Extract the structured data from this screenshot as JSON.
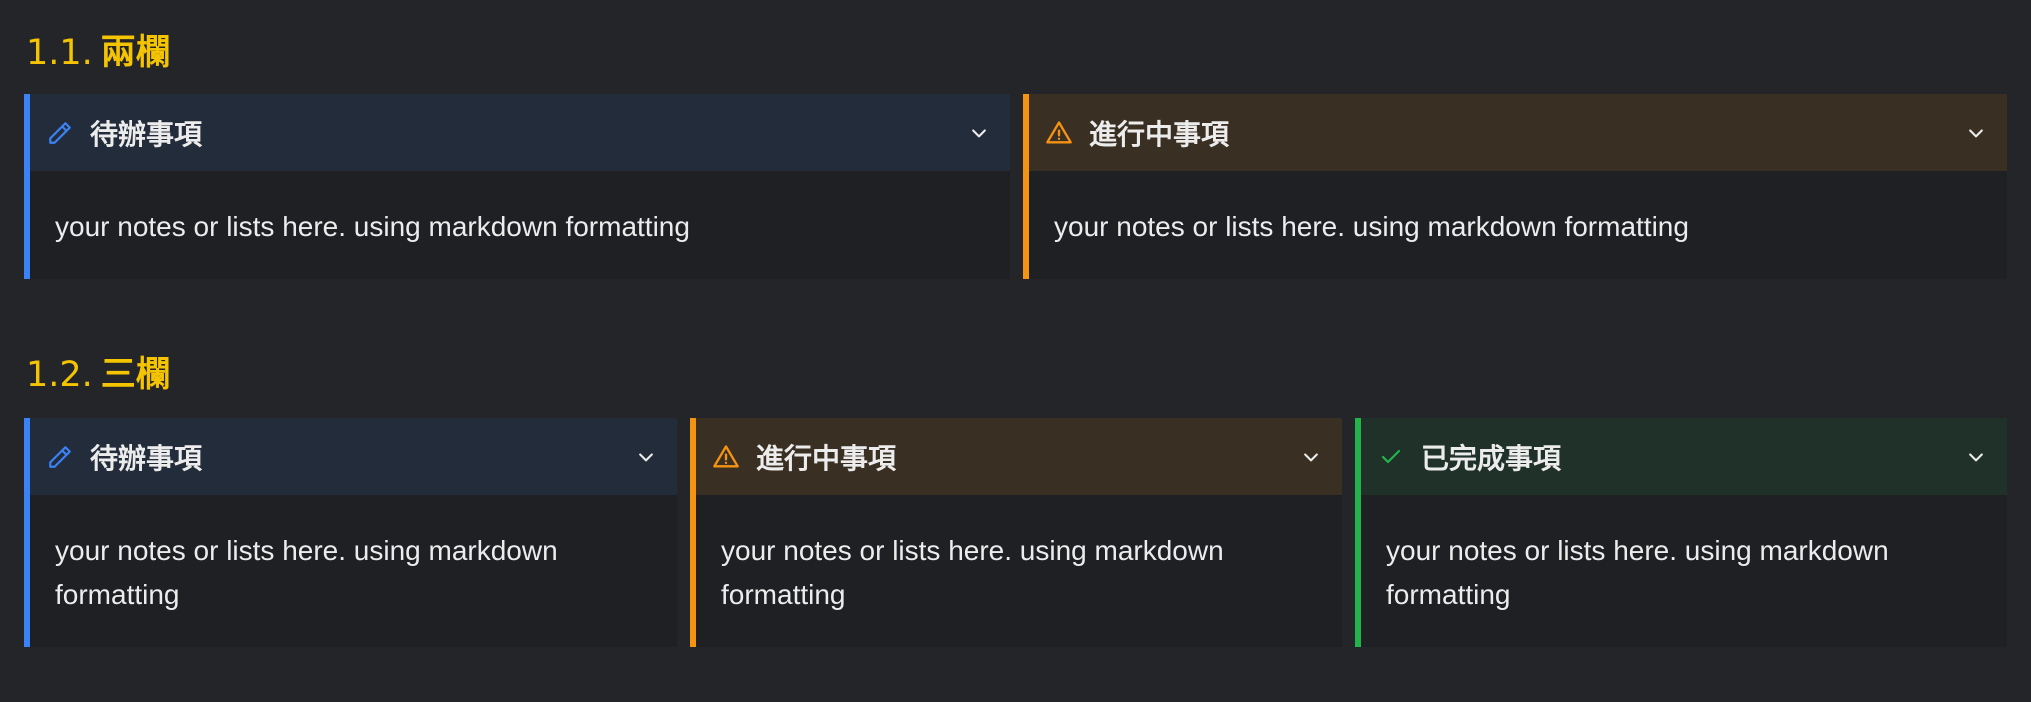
{
  "sections": [
    {
      "number": "1.1.",
      "title": "兩欄",
      "callouts": [
        {
          "icon": "pencil-icon",
          "title": "待辦事項",
          "body": "your notes or lists here. using markdown formatting",
          "color": "#3b82f6"
        },
        {
          "icon": "warning-icon",
          "title": "進行中事項",
          "body": "your notes or lists here. using markdown formatting",
          "color": "#f59312"
        }
      ]
    },
    {
      "number": "1.2.",
      "title": "三欄",
      "callouts": [
        {
          "icon": "pencil-icon",
          "title": "待辦事項",
          "body": "your notes or lists here. using markdown formatting",
          "color": "#3b82f6"
        },
        {
          "icon": "warning-icon",
          "title": "進行中事項",
          "body": "your notes or lists here. using markdown formatting",
          "color": "#f59312"
        },
        {
          "icon": "check-icon",
          "title": "已完成事項",
          "body": "your notes or lists here. using markdown formatting",
          "color": "#22b44a"
        }
      ]
    }
  ],
  "colors": {
    "background": "#242529",
    "heading": "#f5c400",
    "blue": "#3b82f6",
    "orange": "#f59312",
    "green": "#22b44a"
  }
}
